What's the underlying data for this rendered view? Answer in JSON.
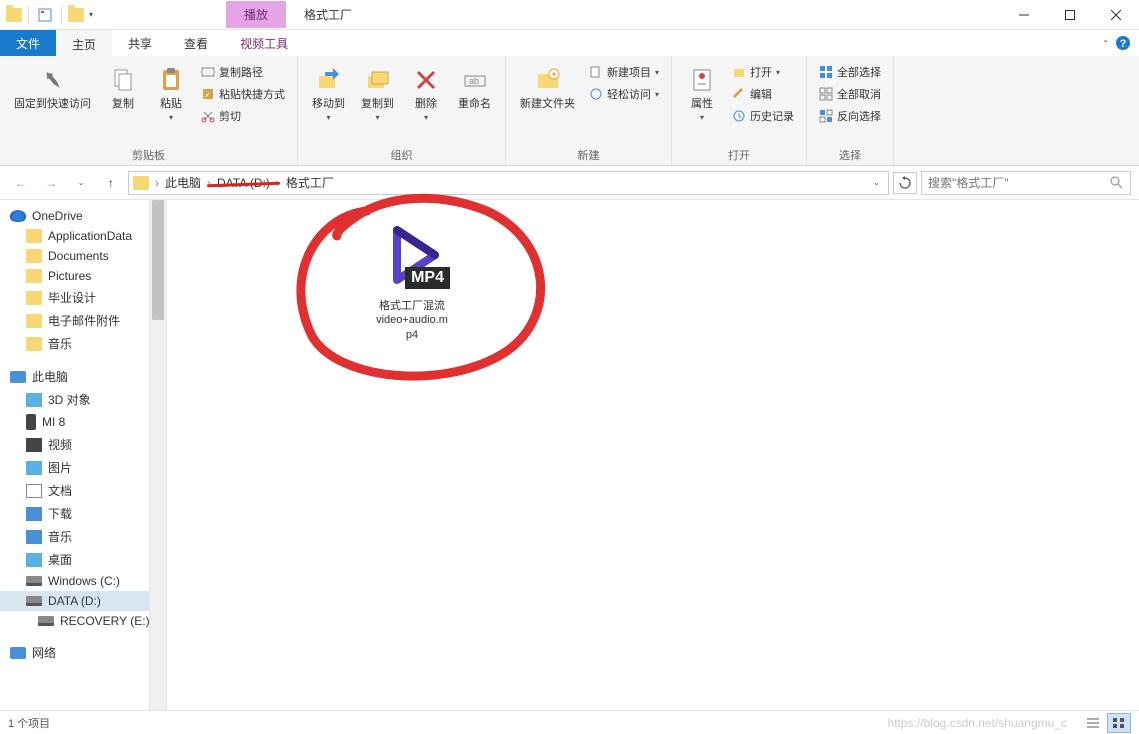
{
  "titlebar": {
    "play_tab": "播放",
    "title": "格式工厂"
  },
  "tabs": {
    "file": "文件",
    "home": "主页",
    "share": "共享",
    "view": "查看",
    "video_tools": "视频工具"
  },
  "ribbon": {
    "clipboard": {
      "pin": "固定到快速访问",
      "copy": "复制",
      "paste": "粘贴",
      "copy_path": "复制路径",
      "paste_shortcut": "粘贴快捷方式",
      "cut": "剪切",
      "label": "剪贴板"
    },
    "organize": {
      "move_to": "移动到",
      "copy_to": "复制到",
      "delete": "删除",
      "rename": "重命名",
      "label": "组织"
    },
    "new": {
      "new_folder": "新建文件夹",
      "new_item": "新建项目",
      "easy_access": "轻松访问",
      "label": "新建"
    },
    "open": {
      "properties": "属性",
      "open": "打开",
      "edit": "编辑",
      "history": "历史记录",
      "label": "打开"
    },
    "select": {
      "select_all": "全部选择",
      "select_none": "全部取消",
      "invert": "反向选择",
      "label": "选择"
    }
  },
  "breadcrumb": {
    "pc": "此电脑",
    "drive": "DATA (D:)",
    "folder": "格式工厂"
  },
  "search": {
    "placeholder": "搜索\"格式工厂\""
  },
  "tree": {
    "onedrive": "OneDrive",
    "items1": [
      "ApplicationData",
      "Documents",
      "Pictures",
      "毕业设计",
      "电子邮件附件",
      "音乐"
    ],
    "this_pc": "此电脑",
    "items2": [
      {
        "label": "3D 对象",
        "icon": "3d"
      },
      {
        "label": "MI 8",
        "icon": "phone"
      },
      {
        "label": "视频",
        "icon": "video"
      },
      {
        "label": "图片",
        "icon": "pic"
      },
      {
        "label": "文档",
        "icon": "doc"
      },
      {
        "label": "下载",
        "icon": "down"
      },
      {
        "label": "音乐",
        "icon": "music"
      },
      {
        "label": "桌面",
        "icon": "desk"
      },
      {
        "label": "Windows (C:)",
        "icon": "drive"
      },
      {
        "label": "DATA (D:)",
        "icon": "drive",
        "selected": true
      },
      {
        "label": "RECOVERY (E:)",
        "icon": "drive"
      }
    ],
    "network": "网络"
  },
  "file": {
    "badge": "MP4",
    "name_l1": "格式工厂混流",
    "name_l2": "video+audio.m",
    "name_l3": "p4"
  },
  "statusbar": {
    "count": "1 个项目",
    "watermark": "https://blog.csdn.net/shuangmu_c"
  }
}
